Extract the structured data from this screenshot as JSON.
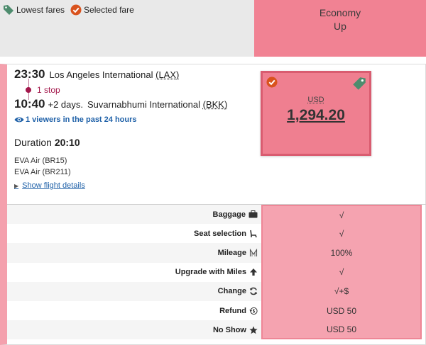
{
  "legend": {
    "lowest_fares": "Lowest fares",
    "selected_fare": "Selected fare"
  },
  "fare_column": {
    "line1": "Economy",
    "line2": "Up"
  },
  "flight": {
    "departure_time": "23:30",
    "departure_airport": "Los Angeles International",
    "departure_code": "(LAX)",
    "stops": "1 stop",
    "arrival_time": "10:40",
    "arrival_days": "+2 days.",
    "arrival_airport": "Suvarnabhumi International",
    "arrival_code": "(BKK)",
    "viewers": "1 viewers in the past 24 hours",
    "duration_label": "Duration",
    "duration_value": "20:10",
    "carriers": [
      "EVA Air (BR15)",
      "EVA Air (BR211)"
    ],
    "details_link": "Show flight details"
  },
  "price": {
    "currency": "USD",
    "amount": "1,294.20"
  },
  "amenities": [
    {
      "label": "Baggage",
      "icon": "suitcase-icon",
      "value": "√"
    },
    {
      "label": "Seat selection",
      "icon": "seat-icon",
      "value": "√"
    },
    {
      "label": "Mileage",
      "icon": "mileage-icon",
      "value": "100%"
    },
    {
      "label": "Upgrade with Miles",
      "icon": "arrow-up-icon",
      "value": "√"
    },
    {
      "label": "Change",
      "icon": "refresh-icon",
      "value": "√+$"
    },
    {
      "label": "Refund",
      "icon": "refund-icon",
      "value": "USD 50"
    },
    {
      "label": "No Show",
      "icon": "star-icon",
      "value": "USD 50"
    }
  ],
  "colors": {
    "fare_pink": "#f18293",
    "selected_border": "#d95c70",
    "check_orange": "#d9531e",
    "tag_green": "#4e8c6e",
    "link_blue": "#1f61a8",
    "stop_magenta": "#a3174b"
  }
}
